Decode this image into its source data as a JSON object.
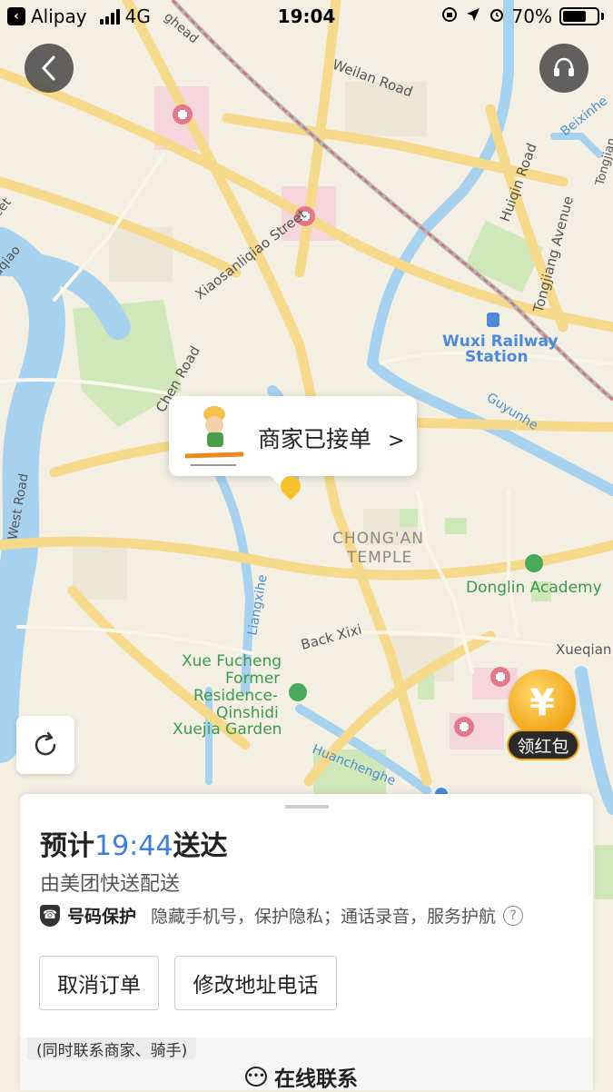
{
  "status_bar": {
    "carrier": "Alipay",
    "network": "4G",
    "time": "19:04",
    "battery": "70%",
    "battery_level": 0.7
  },
  "map": {
    "labels": {
      "weilan_road": "Weilan Road",
      "beixinhe": "Beixinhe",
      "tongjiang": "Tongjian",
      "huiqin_road": "Huiqin Road",
      "tongjiang_avenue": "Tongjiang Avenue",
      "xiaosanliqiao": "Xiaosanliqiao Street",
      "railway_1": "Wuxi Railway",
      "railway_2": "Station",
      "guyunhe": "Guyunhe",
      "chenroad": "Chen Road",
      "chong_an_1": "CHONG'AN",
      "chong_an_2": "TEMPLE",
      "donglin": "Donglin Academy",
      "west_road": "West Road",
      "liangxihe": "Liangxihe",
      "back_xixi": "Back Xixi",
      "xueqian": "Xueqian",
      "xue_1": "Xue Fucheng",
      "xue_2": "Former",
      "xue_3": "Residence-",
      "xue_4": "Qinshidi",
      "xue_5": "Xuejia Garden",
      "huanchenghe": "Huanchenghe",
      "uqiao": "uqiao",
      "et": "eet",
      "chao": "hao",
      "chead": "ghead"
    }
  },
  "store_popup": {
    "status": "商家已接单",
    "chevron": ">"
  },
  "red_packet": {
    "symbol": "¥",
    "label": "领红包"
  },
  "order_sheet": {
    "eta_prefix": "预计",
    "eta_time": "19:44",
    "eta_suffix": "送达",
    "delivered_by": "由美团快送配送",
    "privacy_title": "号码保护",
    "privacy_desc": "隐藏手机号，保护隐私；通话录音，服务护航",
    "help": "?",
    "cancel_button": "取消订单",
    "edit_button": "修改地址电话",
    "contact_note": "(同时联系商家、骑手)",
    "contact_online": "在线联系"
  }
}
